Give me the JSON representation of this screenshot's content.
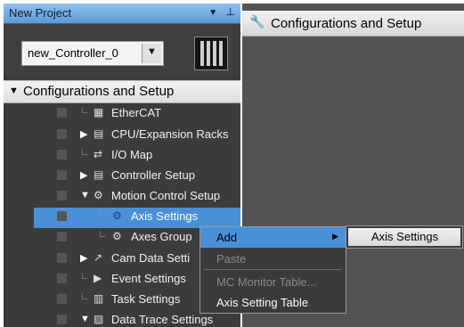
{
  "pane": {
    "title": "New Project",
    "dropdown_icon": "dropdown-arrow-icon",
    "pin_icon": "pin-icon"
  },
  "controller": {
    "name": "new_Controller_0",
    "dropdown_icon": "dropdown-arrow-icon"
  },
  "config_section": {
    "label": "Configurations and Setup",
    "toggle": "▼"
  },
  "tree": {
    "ethercat": "EtherCAT",
    "cpu_racks": "CPU/Expansion Racks",
    "io_map": "I/O Map",
    "controller_setup": "Controller Setup",
    "motion_control": "Motion Control Setup",
    "axis_settings": "Axis Settings",
    "axes_group": "Axes Group",
    "cam_data": "Cam Data Setti",
    "event_settings": "Event Settings",
    "task_settings": "Task Settings",
    "data_trace": "Data Trace Settings"
  },
  "doc_tab": {
    "label": "Configurations and Setup",
    "icon": "wrench-icon"
  },
  "context_menu": {
    "add": "Add",
    "paste": "Paste",
    "mc_monitor": "MC Monitor Table...",
    "axis_setting_table": "Axis Setting Table"
  },
  "submenu": {
    "axis_settings": "Axis Settings"
  },
  "colors": {
    "selection": "#4a90d9",
    "pane_bg": "#3b3b3b",
    "header_blue": "#5e9ad6"
  }
}
